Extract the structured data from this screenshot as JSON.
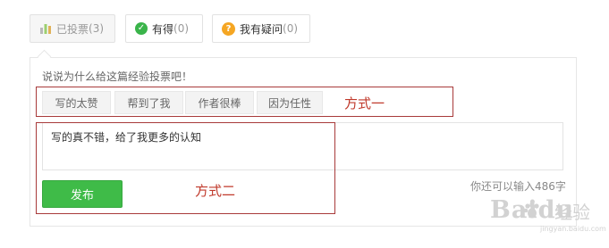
{
  "tabs": [
    {
      "label": "已投票",
      "count": "(3)",
      "icon": "bar-chart-icon"
    },
    {
      "label": "有得",
      "count": "(0)",
      "icon": "check-circle-icon"
    },
    {
      "label": "我有疑问",
      "count": "(0)",
      "icon": "question-circle-icon"
    }
  ],
  "vote_panel": {
    "prompt": "说说为什么给这篇经验投票吧！",
    "reasons": [
      "写的太赞",
      "帮到了我",
      "作者很棒",
      "因为任性"
    ],
    "comment_value": "写的真不错，给了我更多的认知",
    "remaining_text": "你还可以输入486字",
    "publish_label": "发布"
  },
  "annotations": {
    "method_one": "方式一",
    "method_two": "方式二"
  },
  "watermark": {
    "brand": "Baidu",
    "cn": "经验",
    "sub": "jingyan.baidu.com"
  },
  "colors": {
    "accent_green": "#3fbb48",
    "annotation_red": "#c0392b",
    "question_orange": "#f5a623"
  }
}
